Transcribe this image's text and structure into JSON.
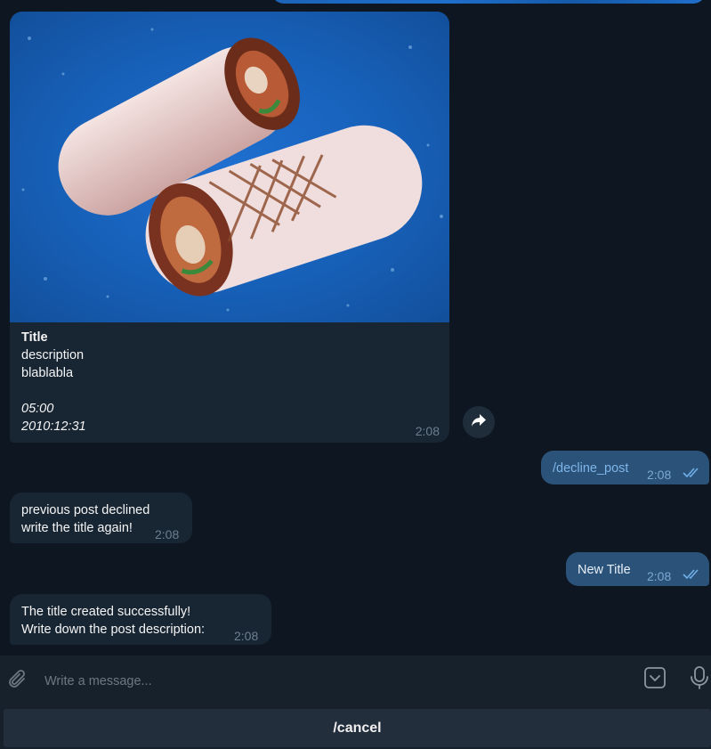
{
  "post": {
    "title": "Title",
    "description": "description",
    "extra": "blablabla",
    "time_value": "05:00",
    "date_value": "2010:12:31",
    "sent_time": "2:08",
    "image_icon": "wrap-sandwich-photo"
  },
  "messages": [
    {
      "text": "/decline_post",
      "time": "2:08"
    },
    {
      "line1": "previous post declined",
      "line2": "write the title again!",
      "time": "2:08"
    },
    {
      "text": "New Title",
      "time": "2:08"
    },
    {
      "line1": "The title created successfully!",
      "line2": "Write down the post description:",
      "time": "2:08"
    }
  ],
  "composer": {
    "placeholder": "Write a message..."
  },
  "keyboard": {
    "cancel_label": "/cancel"
  },
  "colors": {
    "background": "#0e1621",
    "incoming_bubble": "#182533",
    "outgoing_bubble": "#2b5278",
    "accent": "#5eb5f7"
  }
}
